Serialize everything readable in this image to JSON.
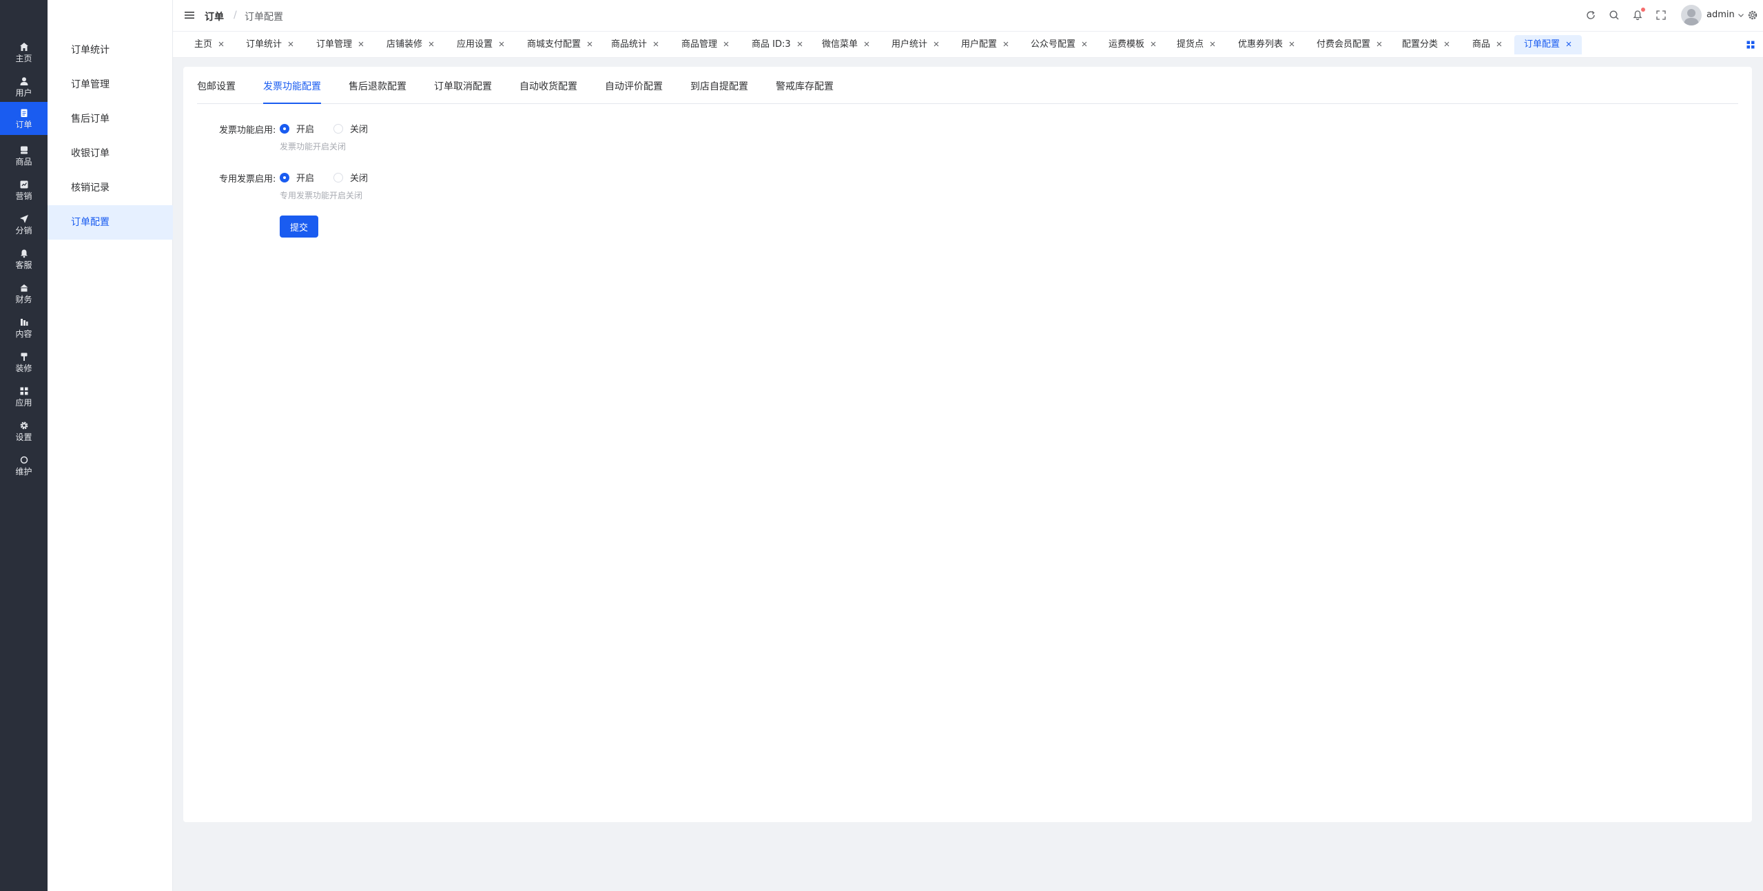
{
  "rail": {
    "items": [
      {
        "label": "主页",
        "icon": "home-icon"
      },
      {
        "label": "用户",
        "icon": "user-icon"
      },
      {
        "label": "订单",
        "icon": "order-icon"
      },
      {
        "label": "商品",
        "icon": "goods-icon"
      },
      {
        "label": "营销",
        "icon": "marketing-icon"
      },
      {
        "label": "分销",
        "icon": "distribution-icon"
      },
      {
        "label": "客服",
        "icon": "bell-icon"
      },
      {
        "label": "财务",
        "icon": "finance-icon"
      },
      {
        "label": "内容",
        "icon": "content-icon"
      },
      {
        "label": "装修",
        "icon": "brush-icon"
      },
      {
        "label": "应用",
        "icon": "apps-icon"
      },
      {
        "label": "设置",
        "icon": "gear-icon"
      },
      {
        "label": "维护",
        "icon": "circle-icon"
      }
    ],
    "active_index": 2,
    "active_color": "#1a5cf0"
  },
  "submenu": {
    "items": [
      "订单统计",
      "订单管理",
      "售后订单",
      "收银订单",
      "核销记录",
      "订单配置"
    ],
    "active_index": 5
  },
  "header": {
    "breadcrumb_root": "订单",
    "breadcrumb_sep": "/",
    "breadcrumb_current": "订单配置",
    "username": "admin"
  },
  "tabs": [
    "主页",
    "订单统计",
    "订单管理",
    "店铺装修",
    "应用设置",
    "商城支付配置",
    "商品统计",
    "商品管理",
    "商品 ID:3",
    "微信菜单",
    "用户统计",
    "用户配置",
    "公众号配置",
    "运费模板",
    "提货点",
    "优惠券列表",
    "付费会员配置",
    "配置分类",
    "商品",
    "订单配置"
  ],
  "active_tab_index": 19,
  "subtabs": [
    "包邮设置",
    "发票功能配置",
    "售后退款配置",
    "订单取消配置",
    "自动收货配置",
    "自动评价配置",
    "到店自提配置",
    "警戒库存配置"
  ],
  "active_subtab_index": 1,
  "form": {
    "field1": {
      "label": "发票功能启用:",
      "on_label": "开启",
      "off_label": "关闭",
      "value": "开启",
      "help": "发票功能开启关闭"
    },
    "field2": {
      "label": "专用发票启用:",
      "on_label": "开启",
      "off_label": "关闭",
      "value": "开启",
      "help": "专用发票功能开启关闭"
    },
    "submit_label": "提交"
  }
}
